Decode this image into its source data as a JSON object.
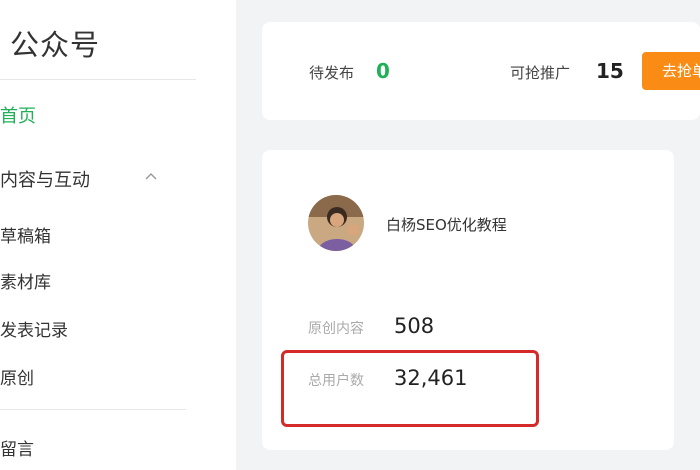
{
  "sidebar": {
    "brand": "公众号",
    "items": [
      {
        "label": "首页"
      },
      {
        "label": "内容与互动"
      },
      {
        "label": "草稿箱"
      },
      {
        "label": "素材库"
      },
      {
        "label": "发表记录"
      },
      {
        "label": "原创"
      },
      {
        "label": "留言"
      }
    ]
  },
  "top_stats": {
    "pending_label": "待发布",
    "pending_value": "0",
    "available_label": "可抢推广",
    "available_value": "15",
    "button_label": "去抢单"
  },
  "profile": {
    "account_name": "白杨SEO优化教程",
    "original_label": "原创内容",
    "original_value": "508",
    "users_label": "总用户数",
    "users_value": "32,461"
  },
  "colors": {
    "accent_green": "#20b058",
    "button_orange": "#fa8c16",
    "highlight_red": "#d42a2a"
  },
  "icons": [
    "chevron-up-icon",
    "avatar"
  ]
}
